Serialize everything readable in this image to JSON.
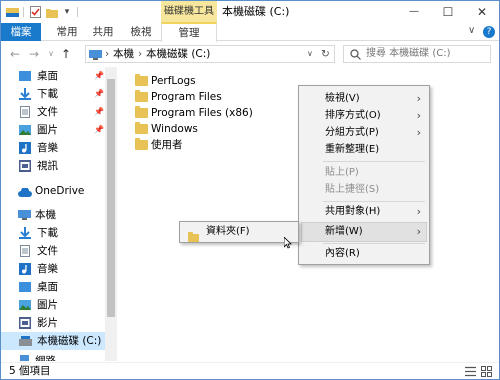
{
  "titlebar": {
    "context_tab": "磁碟機工具",
    "window_title": "本機磁碟 (C:)",
    "minimize": "—",
    "maximize": "☐",
    "close": "✕",
    "qa_more": "▾"
  },
  "ribbon": {
    "tabs": [
      "檔案",
      "常用",
      "共用",
      "檢視",
      "管理"
    ],
    "expand": "∨",
    "help": "?"
  },
  "address": {
    "back": "←",
    "forward": "→",
    "recent": "∨",
    "up": "↑",
    "sep": "›",
    "crumbs": [
      "本機",
      "本機磁碟 (C:)"
    ],
    "dropdown": "∨",
    "refresh": "↻",
    "search_placeholder": "搜尋 本機磁碟 (C:)"
  },
  "sidebar": {
    "quick": [
      {
        "label": "桌面",
        "icon": "desktop-icon",
        "pinned": true
      },
      {
        "label": "下載",
        "icon": "download-icon",
        "pinned": true
      },
      {
        "label": "文件",
        "icon": "document-icon",
        "pinned": true
      },
      {
        "label": "圖片",
        "icon": "picture-icon",
        "pinned": true
      },
      {
        "label": "音樂",
        "icon": "music-icon",
        "pinned": false
      },
      {
        "label": "視訊",
        "icon": "video-icon",
        "pinned": false
      }
    ],
    "onedrive": "OneDrive",
    "thispc": "本機",
    "pc_items": [
      {
        "label": "下載",
        "icon": "download-icon"
      },
      {
        "label": "文件",
        "icon": "document-icon"
      },
      {
        "label": "音樂",
        "icon": "music-icon"
      },
      {
        "label": "桌面",
        "icon": "desktop-icon"
      },
      {
        "label": "圖片",
        "icon": "picture-icon"
      },
      {
        "label": "影片",
        "icon": "video-icon"
      }
    ],
    "local_disk": "本機磁碟 (C:)",
    "network": "網路",
    "pin_glyph": "📌"
  },
  "files": [
    "PerfLogs",
    "Program Files",
    "Program Files (x86)",
    "Windows",
    "使用者"
  ],
  "status": {
    "count": "5 個項目"
  },
  "context_menu": {
    "arrow": "›",
    "items": [
      {
        "label": "檢視(V)",
        "submenu": true,
        "disabled": false
      },
      {
        "label": "排序方式(O)",
        "submenu": true,
        "disabled": false
      },
      {
        "label": "分組方式(P)",
        "submenu": true,
        "disabled": false
      },
      {
        "label": "重新整理(E)",
        "submenu": false,
        "disabled": false
      },
      {
        "label": "貼上(P)",
        "submenu": false,
        "disabled": true
      },
      {
        "label": "貼上捷徑(S)",
        "submenu": false,
        "disabled": true
      },
      {
        "label": "共用對象(H)",
        "submenu": true,
        "disabled": false
      },
      {
        "label": "新增(W)",
        "submenu": true,
        "disabled": false,
        "highlighted": true
      },
      {
        "label": "內容(R)",
        "submenu": false,
        "disabled": false
      }
    ]
  },
  "submenu": {
    "item": "資料夾(F)"
  },
  "colors": {
    "accent": "#1979ca",
    "context_tab": "#f6e79d",
    "folder": "#e8c255",
    "selection": "#cce8ff"
  }
}
